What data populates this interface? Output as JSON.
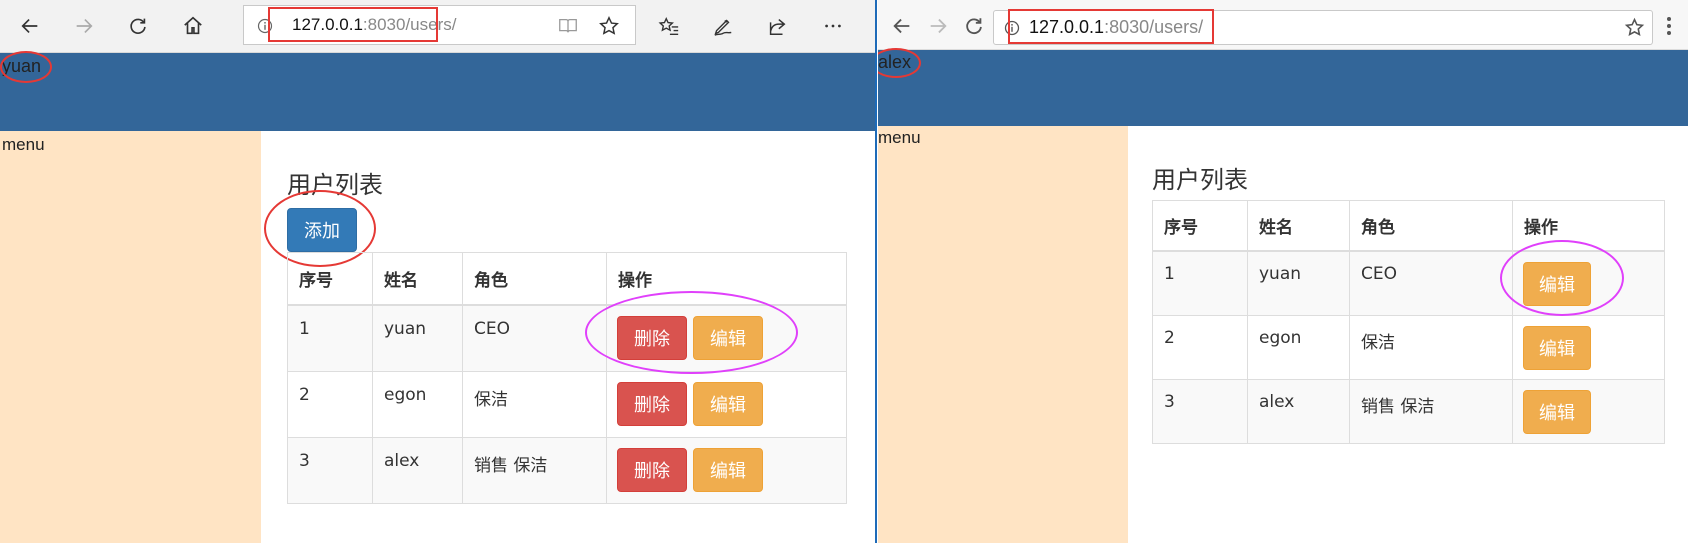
{
  "left_window": {
    "url_host": "127.0.0.1",
    "url_rest": ":8030/users/",
    "user": "yuan",
    "menu_label": "menu",
    "page_title": "用户列表",
    "add_button": "添加",
    "table": {
      "headers": [
        "序号",
        "姓名",
        "角色",
        "操作"
      ],
      "rows": [
        {
          "id": "1",
          "name": "yuan",
          "role": "CEO",
          "delete": "删除",
          "edit": "编辑"
        },
        {
          "id": "2",
          "name": "egon",
          "role": "保洁",
          "delete": "删除",
          "edit": "编辑"
        },
        {
          "id": "3",
          "name": "alex",
          "role": "销售 保洁",
          "delete": "删除",
          "edit": "编辑"
        }
      ]
    }
  },
  "right_window": {
    "url_host": "127.0.0.1",
    "url_rest": ":8030/users/",
    "user": "alex",
    "menu_label": "menu",
    "page_title": "用户列表",
    "table": {
      "headers": [
        "序号",
        "姓名",
        "角色",
        "操作"
      ],
      "rows": [
        {
          "id": "1",
          "name": "yuan",
          "role": "CEO",
          "edit": "编辑"
        },
        {
          "id": "2",
          "name": "egon",
          "role": "保洁",
          "edit": "编辑"
        },
        {
          "id": "3",
          "name": "alex",
          "role": "销售 保洁",
          "edit": "编辑"
        }
      ]
    }
  },
  "colors": {
    "header_bar": "#336699",
    "sidebar": "#ffe4c4",
    "primary": "#337ab7",
    "danger": "#d9534f",
    "warning": "#f0ad4e",
    "annotation_red": "#e53935",
    "annotation_magenta": "#e040fb"
  }
}
